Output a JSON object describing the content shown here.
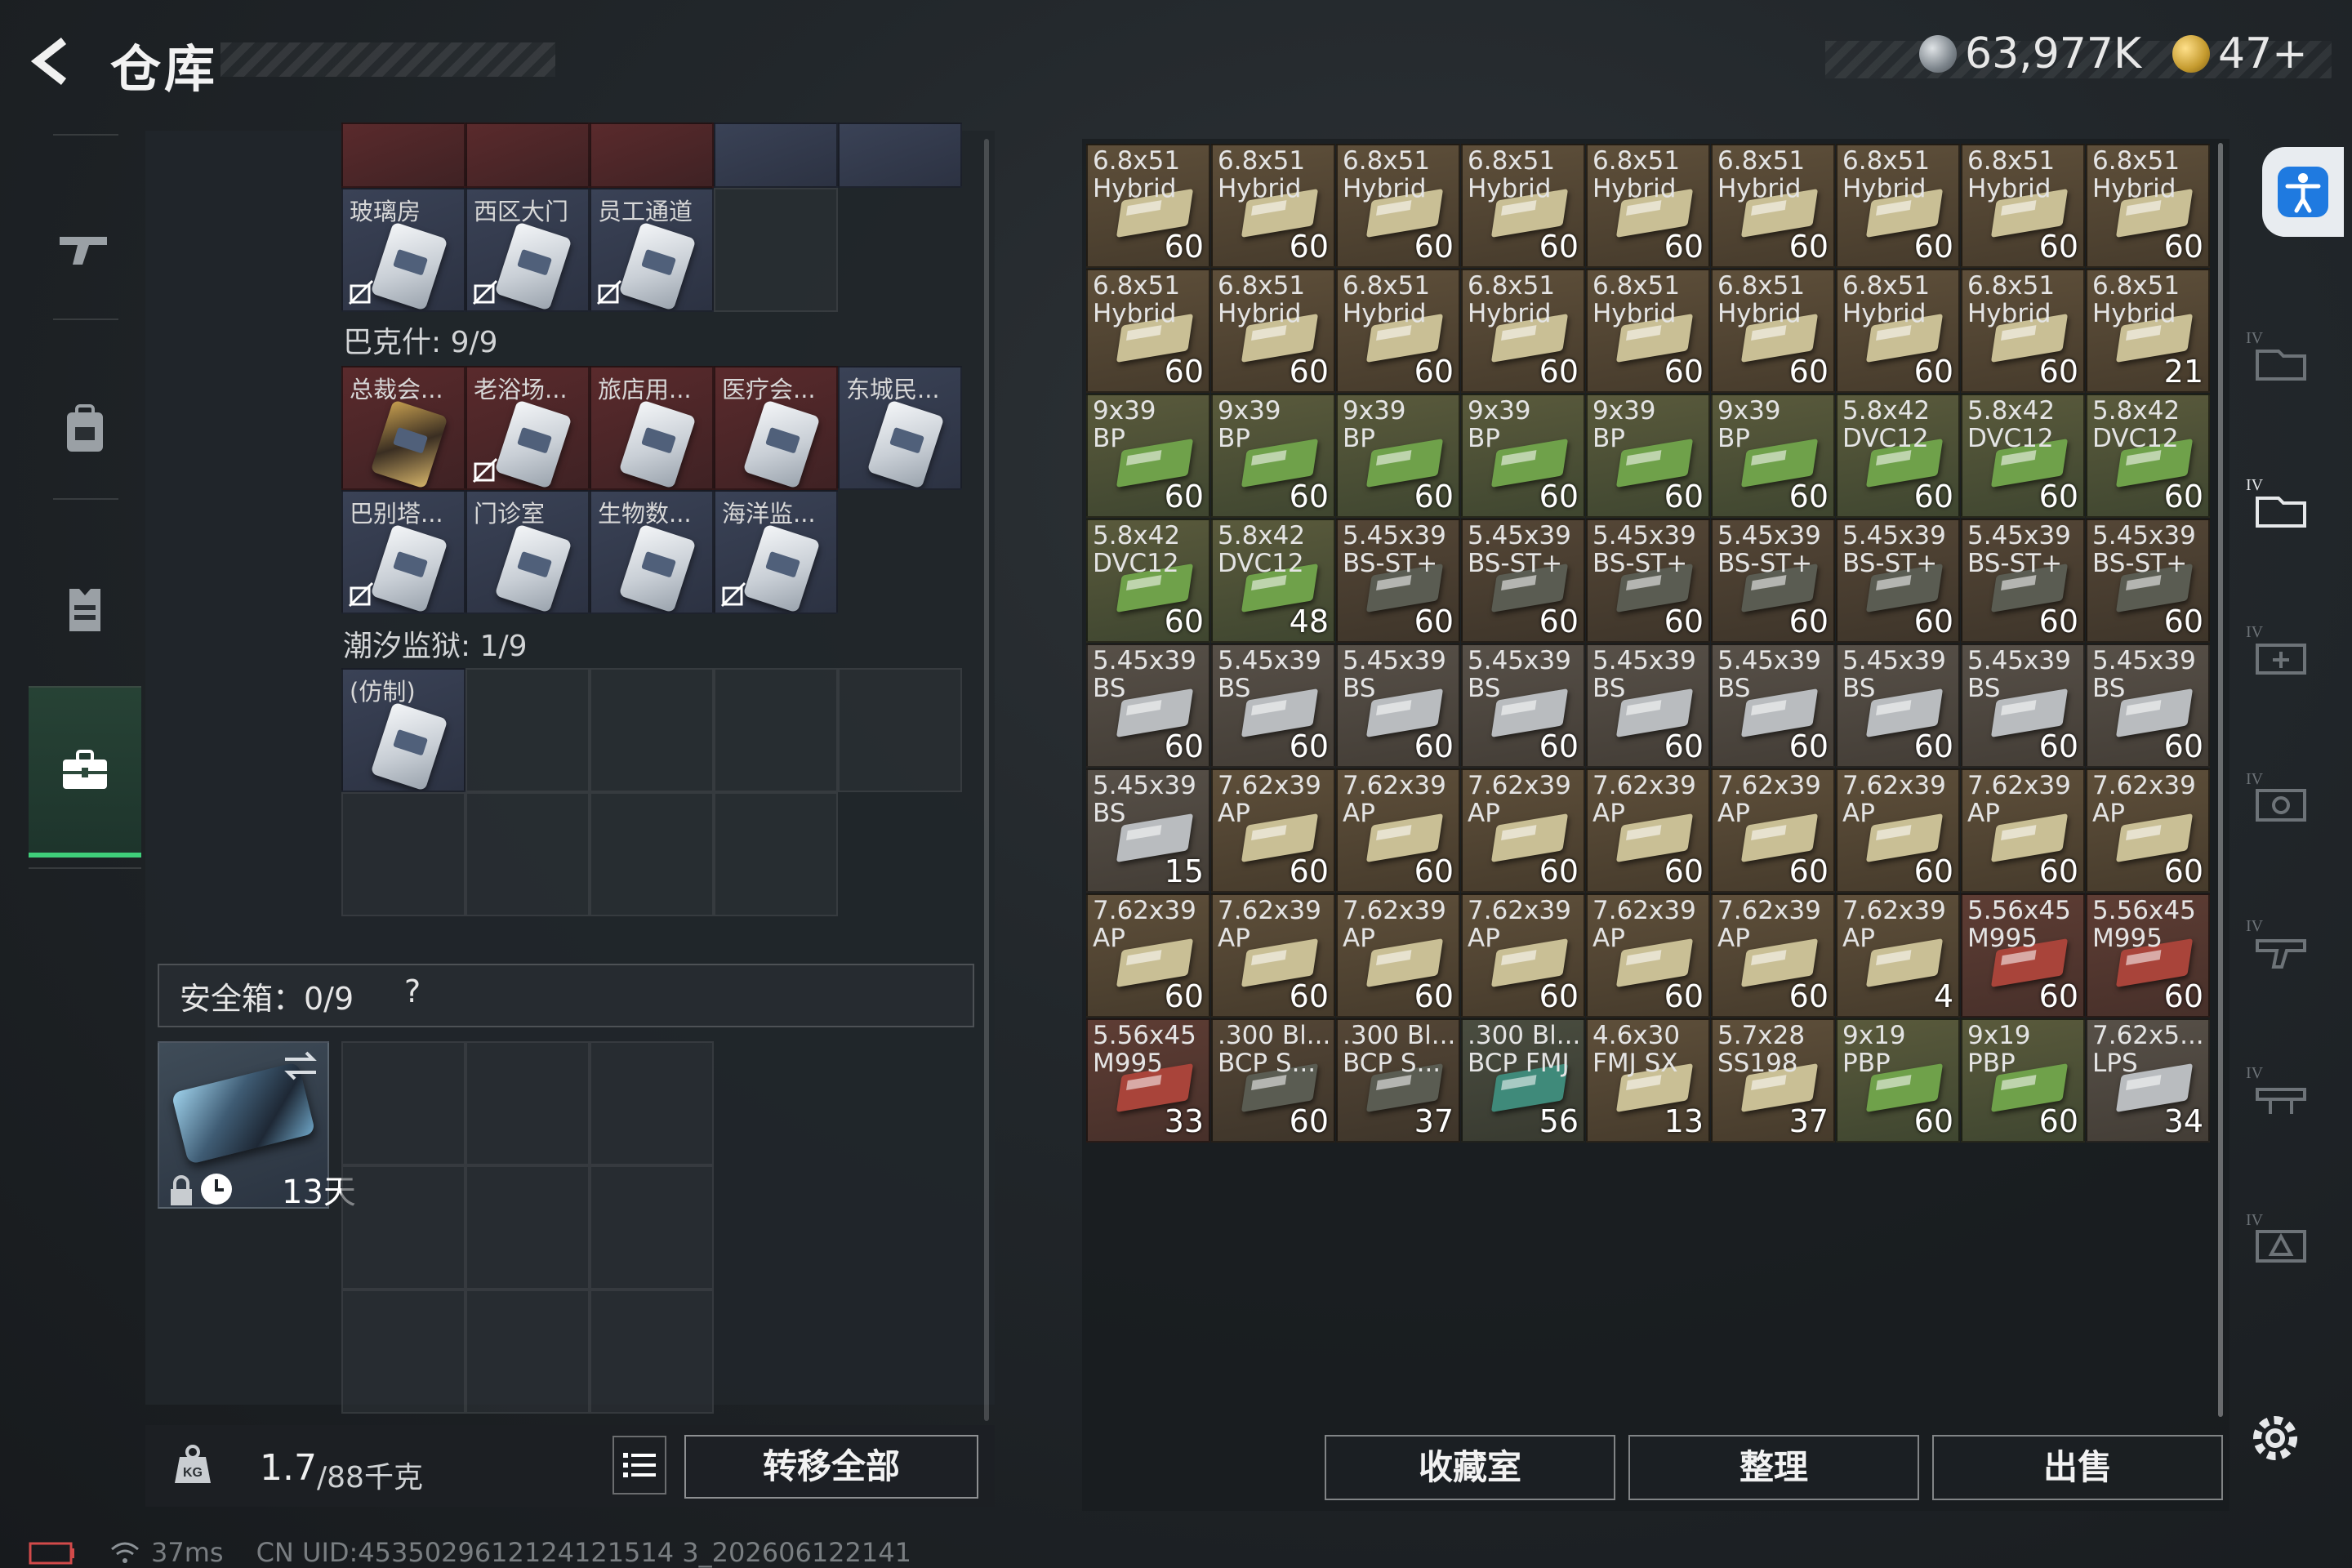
{
  "header": {
    "title": "仓库",
    "currency_main": "63,977K",
    "currency_premium": "47+"
  },
  "left_nav": {
    "items": [
      "weapon-icon",
      "backpack-icon",
      "vest-icon",
      "briefcase-icon"
    ],
    "active_index": 3
  },
  "keycards": {
    "top_row_labels": [
      "玻璃房",
      "西区大门",
      "员工通道"
    ],
    "bakshi_section": "巴克什: 9/9",
    "bakshi_row1": [
      "总裁会...",
      "老浴场...",
      "旅店用...",
      "医疗会...",
      "东城民..."
    ],
    "bakshi_row2": [
      "巴别塔...",
      "门诊室",
      "生物数...",
      "海洋监..."
    ],
    "tide_prison_section": "潮汐监狱: 1/9",
    "tide_prison_items": [
      "(仿制)"
    ]
  },
  "safebox": {
    "label": "安全箱：0/9",
    "help": "?",
    "days_left": "13天"
  },
  "weight": {
    "current": "1.7",
    "max": "/88千克"
  },
  "buttons": {
    "transfer_all": "转移全部",
    "collection": "收藏室",
    "organize": "整理",
    "sell": "出售"
  },
  "status": {
    "ping": "37ms",
    "uid": "CN UID:4535029612124121514 3_202606122141"
  },
  "colors": {
    "accent_green": "#3fcf7a",
    "ammo_tan": "#5c4d38",
    "ammo_green": "#4f6a3b",
    "ammo_red": "#6a3a33"
  },
  "stash": {
    "rows": [
      [
        [
          "6.8x51\nHybrid",
          "60",
          "tan"
        ],
        [
          "6.8x51\nHybrid",
          "60",
          "tan"
        ],
        [
          "6.8x51\nHybrid",
          "60",
          "tan"
        ],
        [
          "6.8x51\nHybrid",
          "60",
          "tan"
        ],
        [
          "6.8x51\nHybrid",
          "60",
          "tan"
        ],
        [
          "6.8x51\nHybrid",
          "60",
          "tan"
        ],
        [
          "6.8x51\nHybrid",
          "60",
          "tan"
        ],
        [
          "6.8x51\nHybrid",
          "60",
          "tan"
        ],
        [
          "6.8x51\nHybrid",
          "60",
          "tan"
        ]
      ],
      [
        [
          "6.8x51\nHybrid",
          "60",
          "tan"
        ],
        [
          "6.8x51\nHybrid",
          "60",
          "tan"
        ],
        [
          "6.8x51\nHybrid",
          "60",
          "tan"
        ],
        [
          "6.8x51\nHybrid",
          "60",
          "tan"
        ],
        [
          "6.8x51\nHybrid",
          "60",
          "tan"
        ],
        [
          "6.8x51\nHybrid",
          "60",
          "tan"
        ],
        [
          "6.8x51\nHybrid",
          "60",
          "tan"
        ],
        [
          "6.8x51\nHybrid",
          "60",
          "tan"
        ],
        [
          "6.8x51\nHybrid",
          "21",
          "tan"
        ]
      ],
      [
        [
          "9x39\nBP",
          "60",
          "green"
        ],
        [
          "9x39\nBP",
          "60",
          "green"
        ],
        [
          "9x39\nBP",
          "60",
          "green"
        ],
        [
          "9x39\nBP",
          "60",
          "green"
        ],
        [
          "9x39\nBP",
          "60",
          "green"
        ],
        [
          "9x39\nBP",
          "60",
          "green"
        ],
        [
          "5.8x42\nDVC12",
          "60",
          "green"
        ],
        [
          "5.8x42\nDVC12",
          "60",
          "green"
        ],
        [
          "5.8x42\nDVC12",
          "60",
          "green"
        ]
      ],
      [
        [
          "5.8x42\nDVC12",
          "60",
          "green"
        ],
        [
          "5.8x42\nDVC12",
          "48",
          "green"
        ],
        [
          "5.45x39\nBS-ST+",
          "60",
          "dark"
        ],
        [
          "5.45x39\nBS-ST+",
          "60",
          "dark"
        ],
        [
          "5.45x39\nBS-ST+",
          "60",
          "dark"
        ],
        [
          "5.45x39\nBS-ST+",
          "60",
          "dark"
        ],
        [
          "5.45x39\nBS-ST+",
          "60",
          "dark"
        ],
        [
          "5.45x39\nBS-ST+",
          "60",
          "dark"
        ],
        [
          "5.45x39\nBS-ST+",
          "60",
          "dark"
        ]
      ],
      [
        [
          "5.45x39\nBS",
          "60",
          "grey"
        ],
        [
          "5.45x39\nBS",
          "60",
          "grey"
        ],
        [
          "5.45x39\nBS",
          "60",
          "grey"
        ],
        [
          "5.45x39\nBS",
          "60",
          "grey"
        ],
        [
          "5.45x39\nBS",
          "60",
          "grey"
        ],
        [
          "5.45x39\nBS",
          "60",
          "grey"
        ],
        [
          "5.45x39\nBS",
          "60",
          "grey"
        ],
        [
          "5.45x39\nBS",
          "60",
          "grey"
        ],
        [
          "5.45x39\nBS",
          "60",
          "grey"
        ]
      ],
      [
        [
          "5.45x39\nBS",
          "15",
          "grey"
        ],
        [
          "7.62x39\nAP",
          "60",
          "tan"
        ],
        [
          "7.62x39\nAP",
          "60",
          "tan"
        ],
        [
          "7.62x39\nAP",
          "60",
          "tan"
        ],
        [
          "7.62x39\nAP",
          "60",
          "tan"
        ],
        [
          "7.62x39\nAP",
          "60",
          "tan"
        ],
        [
          "7.62x39\nAP",
          "60",
          "tan"
        ],
        [
          "7.62x39\nAP",
          "60",
          "tan"
        ],
        [
          "7.62x39\nAP",
          "60",
          "tan"
        ]
      ],
      [
        [
          "7.62x39\nAP",
          "60",
          "tan"
        ],
        [
          "7.62x39\nAP",
          "60",
          "tan"
        ],
        [
          "7.62x39\nAP",
          "60",
          "tan"
        ],
        [
          "7.62x39\nAP",
          "60",
          "tan"
        ],
        [
          "7.62x39\nAP",
          "60",
          "tan"
        ],
        [
          "7.62x39\nAP",
          "60",
          "tan"
        ],
        [
          "7.62x39\nAP",
          "4",
          "tan"
        ],
        [
          "5.56x45\nM995",
          "60",
          "red"
        ],
        [
          "5.56x45\nM995",
          "60",
          "red"
        ]
      ],
      [
        [
          "5.56x45\nM995",
          "33",
          "red"
        ],
        [
          ".300 Bl...\nBCP S...",
          "60",
          "dark"
        ],
        [
          ".300 Bl...\nBCP S...",
          "37",
          "dark"
        ],
        [
          ".300 Bl...\nBCP FMJ",
          "56",
          "teal"
        ],
        [
          "4.6x30\nFMJ SX",
          "13",
          "tan"
        ],
        [
          "5.7x28\nSS198",
          "37",
          "tan"
        ],
        [
          "9x19\nPBP",
          "60",
          "green"
        ],
        [
          "9x19\nPBP",
          "60",
          "green"
        ],
        [
          "7.62x5...\nLPS",
          "34",
          "grey"
        ]
      ]
    ]
  }
}
